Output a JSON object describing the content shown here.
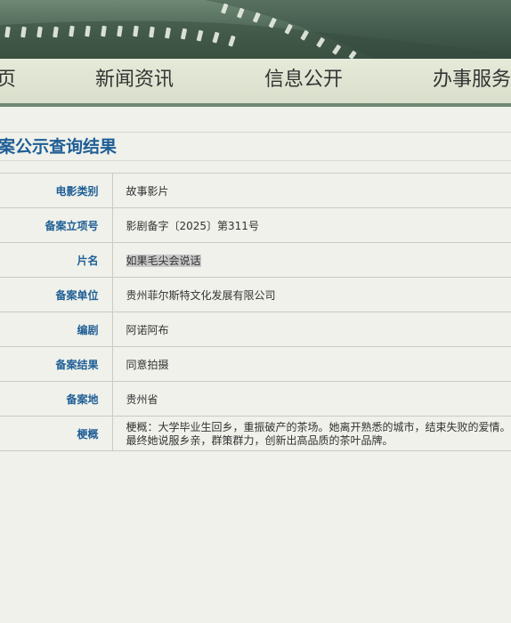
{
  "nav": {
    "items": [
      {
        "label": "页"
      },
      {
        "label": "新闻资讯"
      },
      {
        "label": "信息公开"
      },
      {
        "label": "办事服务"
      }
    ]
  },
  "page": {
    "title": "案公示查询结果"
  },
  "record": [
    {
      "label": "电影类别",
      "value": "故事影片"
    },
    {
      "label": "备案立项号",
      "value": "影剧备字〔2025〕第311号"
    },
    {
      "label": "片名",
      "value": "如果毛尖会说话"
    },
    {
      "label": "备案单位",
      "value": "贵州菲尔斯特文化发展有限公司"
    },
    {
      "label": "编剧",
      "value": "阿诺阿布"
    },
    {
      "label": "备案结果",
      "value": "同意拍摄"
    },
    {
      "label": "备案地",
      "value": "贵州省"
    },
    {
      "label": "梗概",
      "value": "梗概：大学毕业生回乡，重振破产的茶场。她离开熟悉的城市，结束失败的爱情。最终她说服乡亲，群策群力，创新出高品质的茶叶品牌。"
    }
  ],
  "colors": {
    "banner": "#4d6756",
    "nav_bg": "#dde3cf",
    "nav_border": "#6f8775",
    "label_blue": "#1f5e96",
    "highlight": "#c8c8c8"
  }
}
